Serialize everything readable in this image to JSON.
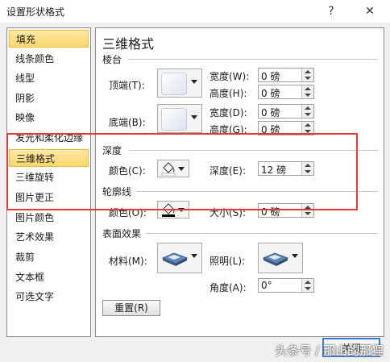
{
  "dialog": {
    "title": "设置形状格式",
    "help_label": "?",
    "close_label": "✕"
  },
  "sidebar": {
    "items": [
      {
        "label": "填充",
        "selected": true
      },
      {
        "label": "线条颜色"
      },
      {
        "label": "线型"
      },
      {
        "label": "阴影"
      },
      {
        "label": "映像"
      },
      {
        "label": "发光和柔化边缘"
      },
      {
        "label": "三维格式",
        "selected": true
      },
      {
        "label": "三维旋转"
      },
      {
        "label": "图片更正"
      },
      {
        "label": "图片颜色"
      },
      {
        "label": "艺术效果"
      },
      {
        "label": "裁剪"
      },
      {
        "label": "文本框"
      },
      {
        "label": "可选文字"
      }
    ]
  },
  "panel": {
    "heading": "三维格式",
    "bevel": {
      "section": "棱台",
      "top_label": "顶端(T):",
      "bottom_label": "底端(B):",
      "width_label": "宽度(W):",
      "height_label": "高度(H):",
      "width2_label": "宽度(D):",
      "height2_label": "高度(G):",
      "top_width": "0 磅",
      "top_height": "0 磅",
      "bottom_width": "0 磅",
      "bottom_height": "0 磅"
    },
    "depth": {
      "section": "深度",
      "color_label": "颜色(C):",
      "depth_label": "深度(E):",
      "depth_value": "12 磅"
    },
    "contour": {
      "section": "轮廓线",
      "color_label": "颜色(O):",
      "size_label": "大小(S):",
      "size_value": "0 磅"
    },
    "surface": {
      "section": "表面效果",
      "material_label": "材料(M):",
      "lighting_label": "照明(L):",
      "angle_label": "角度(A):",
      "angle_value": "0°"
    },
    "reset_label": "重置(R)"
  },
  "close_button_label": "关闭",
  "watermark": "头条号 / 那山的那狸",
  "colors": {
    "selection": "#fcd76a",
    "highlight_box": "#e23b3b",
    "window_bg": "#f0f0f0"
  }
}
